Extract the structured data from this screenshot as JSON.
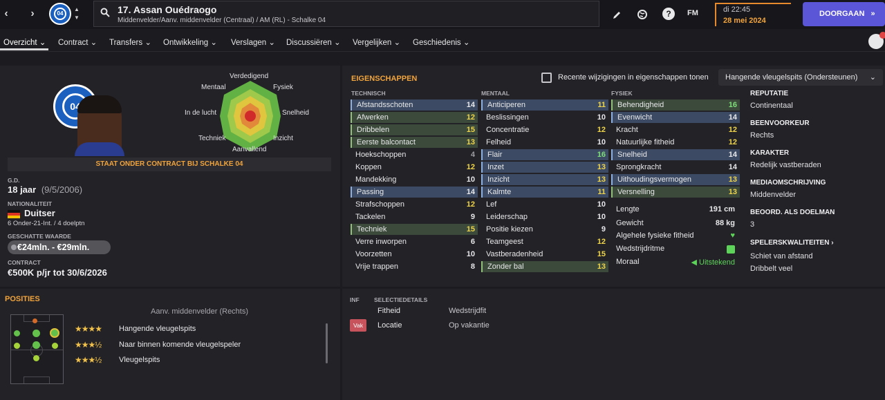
{
  "header": {
    "player_title": "17. Assan Ouédraogo",
    "player_subtitle": "Middenvelder/Aanv. middenvelder (Centraal) / AM (RL) - Schalke 04",
    "club_badge_text": "04",
    "fm_label": "FM",
    "date_time": "di 22:45",
    "date_day": "28 mei 2024",
    "continue_label": "DOORGAAN",
    "icons": [
      "back-icon",
      "forward-icon",
      "search-icon",
      "pencil-icon",
      "globe-icon",
      "help-icon",
      "fast-forward-icon",
      "people-icon"
    ]
  },
  "menu": [
    "Overzicht",
    "Contract",
    "Transfers",
    "Ontwikkeling",
    "Verslagen",
    "Discussiëren",
    "Vergelijken",
    "Geschiedenis"
  ],
  "profile": {
    "radar_labels": [
      "Verdedigend",
      "Fysiek",
      "Snelheid",
      "Inzicht",
      "Aanvallend",
      "Techniek",
      "In de lucht",
      "Mentaal"
    ],
    "contract_banner": "STAAT ONDER CONTRACT BIJ SCHALKE 04",
    "dob_label": "G.D.",
    "age": "18 jaar",
    "dob": "(9/5/2006)",
    "nationality_label": "NATIONALITEIT",
    "nationality": "Duitser",
    "caps": "6 Onder-21-Int. / 4 doelptn",
    "value_label": "GESCHATTE WAARDE",
    "value": "€24mln. - €29mln.",
    "contract_label": "CONTRACT",
    "contract": "€500K p/jr tot 30/6/2026"
  },
  "attributes": {
    "title": "EIGENSCHAPPEN",
    "recent_changes_label": "Recente wijzigingen in eigenschappen tonen",
    "role_select": "Hangende vleugelspits (Ondersteunen)",
    "technical_head": "TECHNISCH",
    "mental_head": "MENTAAL",
    "physical_head": "FYSIEK",
    "technical": [
      {
        "name": "Afstandsschoten",
        "value": "14",
        "hl": "blue",
        "color": "white"
      },
      {
        "name": "Afwerken",
        "value": "12",
        "hl": "green",
        "color": "yellow"
      },
      {
        "name": "Dribbelen",
        "value": "15",
        "hl": "green",
        "color": "yellow"
      },
      {
        "name": "Eerste balcontact",
        "value": "13",
        "hl": "green",
        "color": "yellow"
      },
      {
        "name": "Hoekschoppen",
        "value": "4",
        "hl": "",
        "color": "gray"
      },
      {
        "name": "Koppen",
        "value": "12",
        "hl": "",
        "color": "yellow"
      },
      {
        "name": "Mandekking",
        "value": "10",
        "hl": "",
        "color": "white"
      },
      {
        "name": "Passing",
        "value": "14",
        "hl": "blue",
        "color": "white"
      },
      {
        "name": "Strafschoppen",
        "value": "12",
        "hl": "",
        "color": "yellow"
      },
      {
        "name": "Tackelen",
        "value": "9",
        "hl": "",
        "color": "white"
      },
      {
        "name": "Techniek",
        "value": "15",
        "hl": "green",
        "color": "yellow"
      },
      {
        "name": "Verre inworpen",
        "value": "6",
        "hl": "",
        "color": "white"
      },
      {
        "name": "Voorzetten",
        "value": "10",
        "hl": "",
        "color": "white"
      },
      {
        "name": "Vrije trappen",
        "value": "8",
        "hl": "",
        "color": "white"
      }
    ],
    "mental": [
      {
        "name": "Anticiperen",
        "value": "11",
        "hl": "blue",
        "color": "yellow"
      },
      {
        "name": "Beslissingen",
        "value": "10",
        "hl": "",
        "color": "white"
      },
      {
        "name": "Concentratie",
        "value": "12",
        "hl": "",
        "color": "yellow"
      },
      {
        "name": "Felheid",
        "value": "10",
        "hl": "",
        "color": "white"
      },
      {
        "name": "Flair",
        "value": "16",
        "hl": "blue",
        "color": "green"
      },
      {
        "name": "Inzet",
        "value": "13",
        "hl": "blue",
        "color": "yellow"
      },
      {
        "name": "Inzicht",
        "value": "13",
        "hl": "blue",
        "color": "yellow"
      },
      {
        "name": "Kalmte",
        "value": "11",
        "hl": "blue",
        "color": "yellow"
      },
      {
        "name": "Lef",
        "value": "10",
        "hl": "",
        "color": "white"
      },
      {
        "name": "Leiderschap",
        "value": "10",
        "hl": "",
        "color": "white"
      },
      {
        "name": "Positie kiezen",
        "value": "9",
        "hl": "",
        "color": "white"
      },
      {
        "name": "Teamgeest",
        "value": "12",
        "hl": "",
        "color": "yellow"
      },
      {
        "name": "Vastberadenheid",
        "value": "15",
        "hl": "",
        "color": "yellow"
      },
      {
        "name": "Zonder bal",
        "value": "13",
        "hl": "green",
        "color": "yellow"
      }
    ],
    "physical": [
      {
        "name": "Behendigheid",
        "value": "16",
        "hl": "green",
        "color": "green"
      },
      {
        "name": "Evenwicht",
        "value": "14",
        "hl": "blue",
        "color": "white"
      },
      {
        "name": "Kracht",
        "value": "12",
        "hl": "",
        "color": "yellow"
      },
      {
        "name": "Natuurlijke fitheid",
        "value": "12",
        "hl": "",
        "color": "yellow"
      },
      {
        "name": "Snelheid",
        "value": "14",
        "hl": "blue",
        "color": "white"
      },
      {
        "name": "Sprongkracht",
        "value": "14",
        "hl": "",
        "color": "white"
      },
      {
        "name": "Uithoudingsvermogen",
        "value": "13",
        "hl": "blue",
        "color": "yellow"
      },
      {
        "name": "Versnelling",
        "value": "13",
        "hl": "green",
        "color": "yellow"
      }
    ],
    "physical_info": {
      "length_label": "Lengte",
      "length": "191 cm",
      "weight_label": "Gewicht",
      "weight": "88 kg",
      "fitness_label": "Algehele fysieke fitheid",
      "match_rhythm_label": "Wedstrijdritme",
      "morale_label": "Moraal",
      "morale": "Uitstekend"
    }
  },
  "side": {
    "reputation_label": "REPUTATIE",
    "reputation": "Continentaal",
    "foot_label": "BEENVOORKEUR",
    "foot": "Rechts",
    "character_label": "KARAKTER",
    "character": "Redelijk vastberaden",
    "media_label": "MEDIAOMSCHRIJVING",
    "media": "Middenvelder",
    "gk_label": "BEOORD. ALS DOELMAN",
    "gk": "3",
    "traits_label": "SPELERSKWALITEITEN",
    "traits": [
      "Schiet van afstand",
      "Dribbelt veel"
    ]
  },
  "positions": {
    "title": "POSITIES",
    "main_position": "Aanv. middenvelder (Rechts)",
    "roles": [
      {
        "stars": "★★★★",
        "name": "Hangende vleugelspits"
      },
      {
        "stars": "★★★½",
        "name": "Naar binnen komende vleugelspeler"
      },
      {
        "stars": "★★★½",
        "name": "Vleugelspits"
      }
    ]
  },
  "selection": {
    "inf_head": "INF",
    "details_head": "SELECTIEDETAILS",
    "rows": [
      {
        "badge": "",
        "label": "Fitheid",
        "value": "Wedstrijdfit"
      },
      {
        "badge": "Vak",
        "label": "Locatie",
        "value": "Op vakantie"
      }
    ]
  },
  "colors": {
    "accent": "#f2a43c",
    "button": "#5b55d8",
    "highlight_blue": "#3c4b63",
    "highlight_green": "#3b4a3a",
    "value_green": "#7fe07a",
    "value_yellow": "#f0d54a"
  }
}
